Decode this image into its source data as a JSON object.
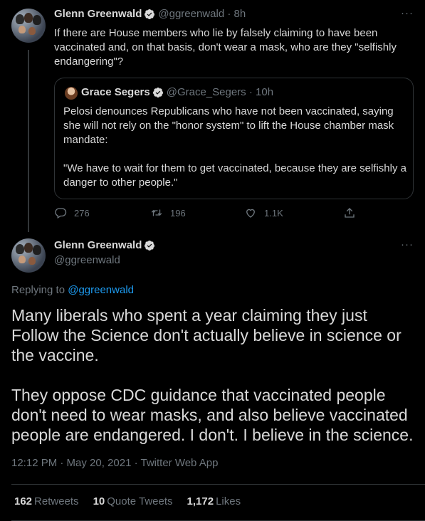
{
  "tweet1": {
    "name": "Glenn Greenwald",
    "handle": "@ggreenwald · 8h",
    "text": "If there are House members who lie by falsely claiming to have been vaccinated and, on that basis, don't wear a mask, who are they \"selfishly endangering\"?",
    "more": "···",
    "quote": {
      "name": "Grace Segers",
      "handle": "@Grace_Segers · 10h",
      "text1": "Pelosi denounces Republicans who have not been vaccinated, saying she will not rely on the \"honor system\" to lift the House chamber mask mandate:",
      "text2": "\"We have to wait for them to get vaccinated, because they are selfishly a danger to other people.\""
    },
    "actions": {
      "replies": "276",
      "retweets": "196",
      "likes": "1.1K"
    }
  },
  "tweet2": {
    "name": "Glenn Greenwald",
    "handle": "@ggreenwald",
    "more": "···",
    "replying_prefix": "Replying to ",
    "replying_handle": "@ggreenwald",
    "para1": "Many liberals who spent a year claiming they just Follow the Science don't actually believe in science or the vaccine.",
    "para2": "They oppose CDC guidance that vaccinated people don't need to wear masks, and also believe vaccinated people are endangered. I don't. I believe in the science.",
    "meta": "12:12 PM · May 20, 2021 · Twitter Web App",
    "stats": {
      "retweets_count": "162",
      "retweets_label": "Retweets",
      "quotes_count": "10",
      "quotes_label": "Quote Tweets",
      "likes_count": "1,172",
      "likes_label": "Likes"
    }
  },
  "colors": {
    "background": "#000000",
    "text": "#d9d9d9",
    "secondary": "#6e767d",
    "link": "#1d9bf0",
    "border": "#2f3336"
  }
}
